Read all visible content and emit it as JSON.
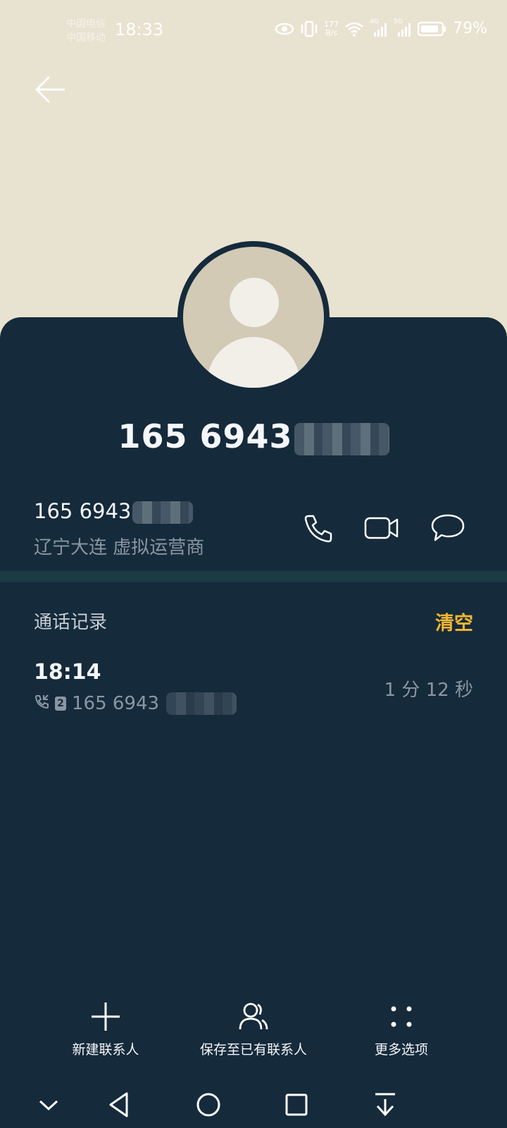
{
  "status_bar": {
    "carrier_1": "中国电信",
    "carrier_2": "中国移动",
    "time": "18:33",
    "net_speed_value": "177",
    "net_speed_unit": "B/s",
    "signal_1_label": "4G",
    "signal_2_label": "5G",
    "battery_percent": "79%"
  },
  "contact": {
    "title_number": "165 6943",
    "number": "165 6943",
    "location": "辽宁大连 虚拟运营商"
  },
  "history": {
    "title": "通话记录",
    "clear_label": "清空",
    "records": [
      {
        "time": "18:14",
        "sim": "2",
        "number": "165 6943",
        "duration": "1 分 12 秒"
      }
    ]
  },
  "bottom_actions": {
    "new_contact": "新建联系人",
    "save_existing": "保存至已有联系人",
    "more_options": "更多选项"
  },
  "colors": {
    "sheet_bg": "#152a3b",
    "header_bg": "#e8e2d0",
    "accent": "#f5b731"
  }
}
